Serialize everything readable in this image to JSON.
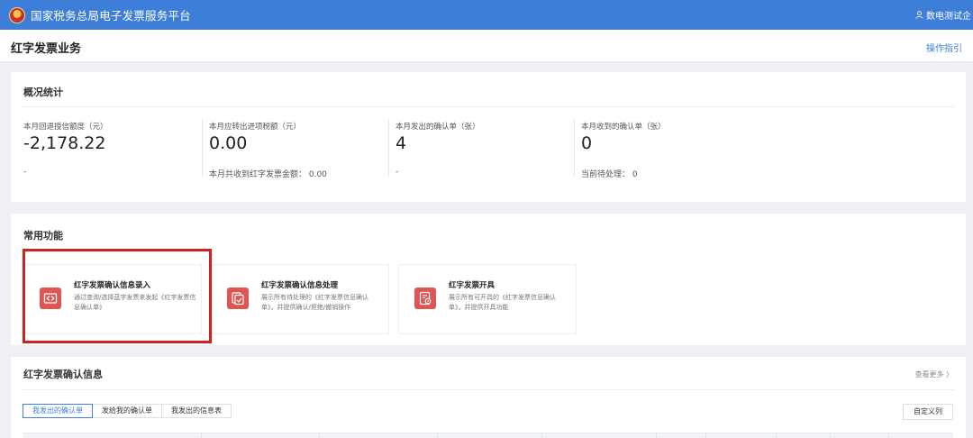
{
  "topbar": {
    "app_title": "国家税务总局电子发票服务平台",
    "user_name": "数电测试企"
  },
  "page": {
    "title": "红字发票业务",
    "help_link": "操作指引"
  },
  "stats": {
    "title": "概况统计",
    "items": [
      {
        "label": "本月回退授信额度（元）",
        "value": "-2,178.22",
        "foot": "-"
      },
      {
        "label": "本月应转出进项税额（元）",
        "value": "0.00",
        "foot": "本月共收到红字发票金额： 0.00"
      },
      {
        "label": "本月发出的确认单（张）",
        "value": "4",
        "foot": "-"
      },
      {
        "label": "本月收到的确认单（张）",
        "value": "0",
        "foot": "当前待处理： 0"
      }
    ]
  },
  "functions": {
    "title": "常用功能",
    "items": [
      {
        "name": "红字发票确认信息录入",
        "desc": "通过查询/选择蓝字发票来发起《红字发票信息确认单》",
        "icon": "invoice-entry-icon"
      },
      {
        "name": "红字发票确认信息处理",
        "desc": "展示所有待处理的《红字发票信息确认单》，并提供确认/拒绝/撤销操作",
        "icon": "invoice-process-icon"
      },
      {
        "name": "红字发票开具",
        "desc": "展示所有可开具的《红字发票信息确认单》，并提供开具功能",
        "icon": "invoice-issue-icon"
      }
    ]
  },
  "confirm": {
    "title": "红字发票确认信息",
    "more": "查看更多 〉",
    "tabs": [
      "我发出的确认单",
      "发给我的确认单",
      "我发出的信息表"
    ],
    "active_tab": 0,
    "custom_columns": "自定义列"
  },
  "colors": {
    "brand_blue": "#3d7fd8",
    "icon_red": "#de5653",
    "highlight_red": "#d21f1f"
  }
}
